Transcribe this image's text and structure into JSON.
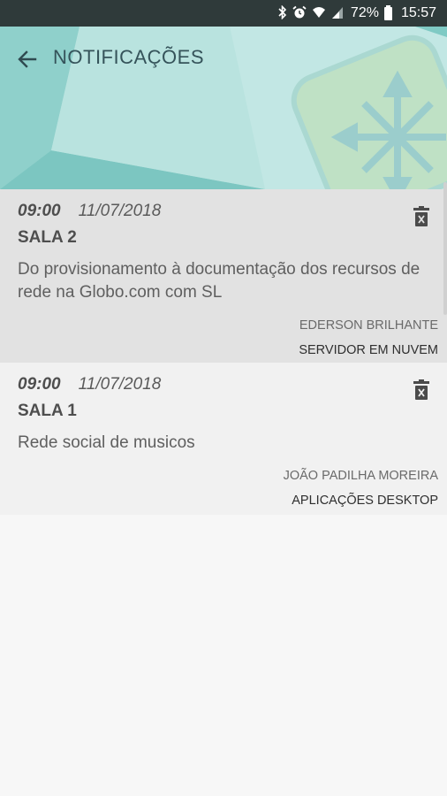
{
  "status_bar": {
    "battery_level": "72%",
    "clock": "15:57",
    "icons": [
      "bluetooth-icon",
      "alarm-icon",
      "wifi-icon",
      "signal-icon",
      "battery-icon"
    ]
  },
  "header": {
    "title": "NOTIFICAÇÕES",
    "back_icon": "arrow-left-icon",
    "background_color": "#aeded9"
  },
  "notifications": [
    {
      "time": "09:00",
      "date": "11/07/2018",
      "room": "SALA 2",
      "description": "Do provisionamento à documentação dos recursos de rede na Globo.com com SL",
      "speaker": "EDERSON BRILHANTE",
      "track": "SERVIDOR EM NUVEM",
      "selected": true
    },
    {
      "time": "09:00",
      "date": "11/07/2018",
      "room": "SALA 1",
      "description": "Rede social de musicos",
      "speaker": "JOÃO PADILHA MOREIRA",
      "track": "APLICAÇÕES DESKTOP",
      "selected": false
    }
  ],
  "colors": {
    "status_bar": "#2f3a3a",
    "header_bg": "#aeded9",
    "selected_card": "#e2e2e2",
    "card": "#f1f1f1",
    "page_bg": "#f7f7f7"
  }
}
